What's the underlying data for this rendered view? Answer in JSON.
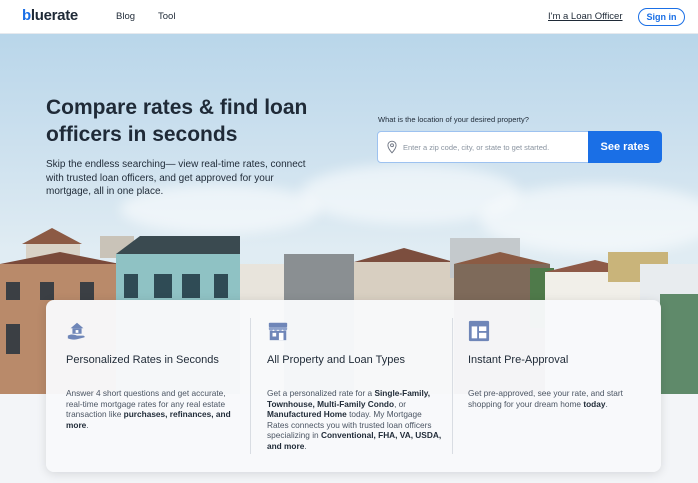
{
  "header": {
    "logo_b": "b",
    "logo_rest": "luerate",
    "nav": [
      {
        "label": "Blog"
      },
      {
        "label": "Tool"
      }
    ],
    "loan_officer_link": "I'm a Loan Officer",
    "sign_in": "Sign in"
  },
  "hero": {
    "title": "Compare rates & find loan officers in seconds",
    "subtitle": "Skip the endless searching— view real-time rates, connect with trusted loan officers, and get approved for your mortgage, all in one place.",
    "location_label": "What is the location of your desired property?",
    "search_placeholder": "Enter a zip code, city, or state to get started.",
    "cta": "See rates"
  },
  "features": [
    {
      "icon": "hand-house-icon",
      "title": "Personalized Rates in Seconds",
      "body_parts": [
        {
          "text": "Answer 4 short questions and get accurate, real-time mortgage rates for any real estate transaction like ",
          "bold": false
        },
        {
          "text": "purchases, refinances, and more",
          "bold": true
        },
        {
          "text": ".",
          "bold": false
        }
      ]
    },
    {
      "icon": "storefront-icon",
      "title": "All Property and Loan Types",
      "body_parts": [
        {
          "text": "Get a personalized rate for a ",
          "bold": false
        },
        {
          "text": "Single-Family, Townhouse, Multi-Family Condo",
          "bold": true
        },
        {
          "text": ", or ",
          "bold": false
        },
        {
          "text": "Manufactured Home",
          "bold": true
        },
        {
          "text": " today. My Mortgage Rates connects you with trusted loan officers specializing in ",
          "bold": false
        },
        {
          "text": "Conventional, FHA, VA, USDA, and more",
          "bold": true
        },
        {
          "text": ".",
          "bold": false
        }
      ]
    },
    {
      "icon": "layout-grid-icon",
      "title": "Instant Pre-Approval",
      "body_parts": [
        {
          "text": "Get pre-approved, see your rate, and start shopping for your dream home ",
          "bold": false
        },
        {
          "text": "today",
          "bold": true
        },
        {
          "text": ".",
          "bold": false
        }
      ]
    }
  ],
  "colors": {
    "accent": "#1a6fe6",
    "text": "#1f2a37",
    "icon": "#6f86b8"
  }
}
